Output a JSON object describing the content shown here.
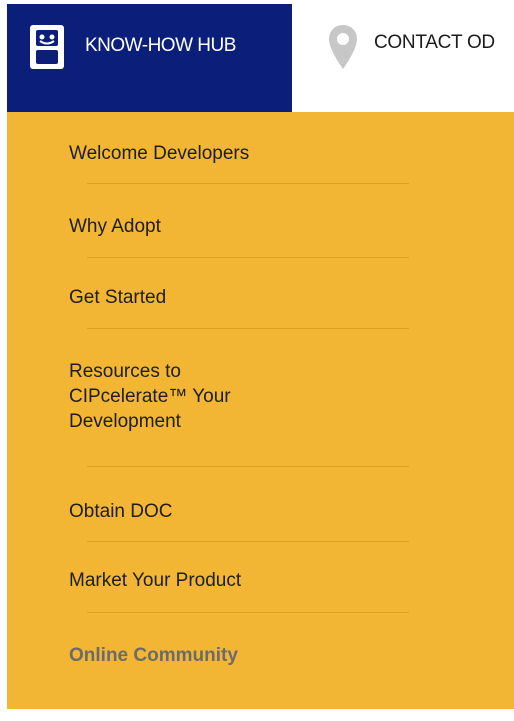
{
  "topnav": {
    "active_tab": {
      "label": "KNOW-HOW HUB",
      "icon": "hub-robot-icon"
    },
    "contact_tab": {
      "label": "CONTACT OD",
      "icon": "map-pin-icon"
    }
  },
  "dropdown": {
    "items": [
      {
        "label": "Welcome Developers"
      },
      {
        "label": "Why Adopt"
      },
      {
        "label": "Get Started"
      },
      {
        "label": "Resources to\nCIPcelerate™ Your\nDevelopment"
      },
      {
        "label": "Obtain DOC"
      },
      {
        "label": "Market Your Product"
      },
      {
        "label": "Online Community"
      }
    ]
  },
  "colors": {
    "nav_active_bg": "#0b1f7a",
    "dropdown_bg": "#f3b634",
    "divider": "#d99a1c",
    "muted_text": "#6b6b6b"
  }
}
